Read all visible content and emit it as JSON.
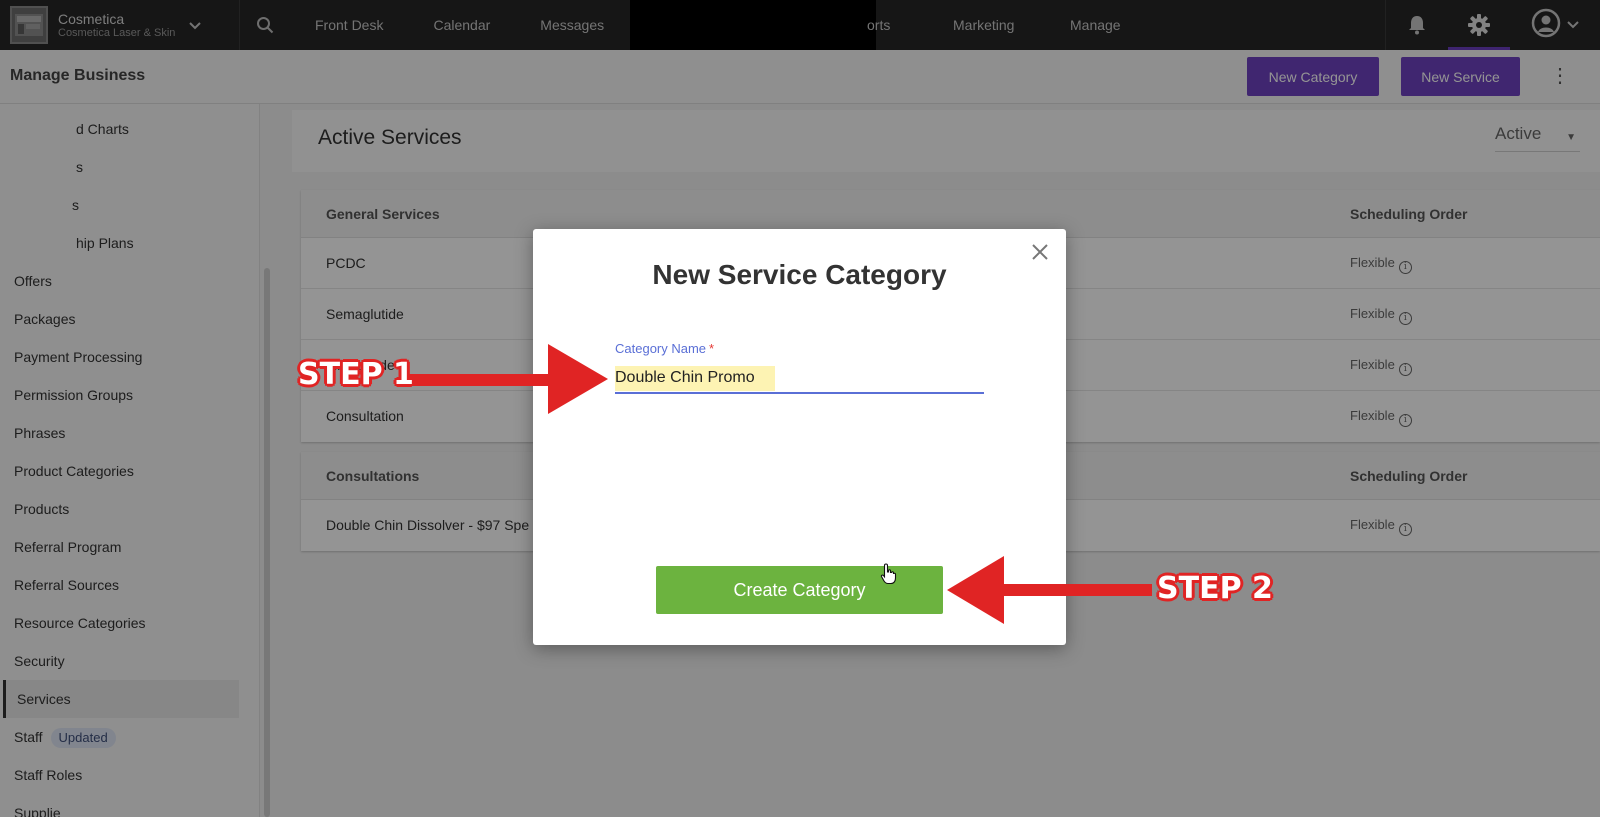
{
  "topnav": {
    "brand_name": "Cosmetica",
    "brand_sub": "Cosmetica Laser & Skin",
    "items": [
      "Front Desk",
      "Calendar",
      "Messages"
    ],
    "reports_fragment": "orts",
    "marketing": "Marketing",
    "manage": "Manage",
    "icons": [
      "search-icon",
      "bell-icon",
      "gear-icon",
      "user-icon"
    ]
  },
  "subheader": {
    "title": "Manage Business",
    "new_category": "New Category",
    "new_service": "New Service"
  },
  "sidebar": {
    "items": [
      "d Charts",
      "s",
      "s",
      "hip Plans",
      "Offers",
      "Packages",
      "Payment Processing",
      "Permission Groups",
      "Phrases",
      "Product Categories",
      "Products",
      "Referral Program",
      "Referral Sources",
      "Resource Categories",
      "Security",
      "Services",
      "Staff",
      "Staff Roles",
      "Supplie"
    ],
    "staff_badge": "Updated",
    "active_item": "Services"
  },
  "main": {
    "title": "Active Services",
    "status_filter": "Active",
    "tables": [
      {
        "category": "General Services",
        "order_header": "Scheduling Order",
        "rows": [
          {
            "name": "PCDC",
            "order": "Flexible"
          },
          {
            "name": "Semaglutide",
            "order": "Flexible"
          },
          {
            "name": "Tirzepatide",
            "order": "Flexible"
          },
          {
            "name": "Consultation",
            "order": "Flexible"
          }
        ]
      },
      {
        "category": "Consultations",
        "order_header": "Scheduling Order",
        "rows": [
          {
            "name": "Double Chin Dissolver - $97 Spe",
            "order": "Flexible"
          }
        ]
      }
    ]
  },
  "modal": {
    "title": "New Service Category",
    "field_label": "Category Name",
    "required_mark": "*",
    "field_value": "Double Chin Promo",
    "create_button": "Create Category"
  },
  "annotations": {
    "step1": "STEP 1",
    "step2": "STEP 2",
    "color": "#e02424"
  },
  "colors": {
    "accent_purple": "#6f42c1",
    "create_green": "#6cb33f",
    "field_blue": "#5a6fd6"
  }
}
